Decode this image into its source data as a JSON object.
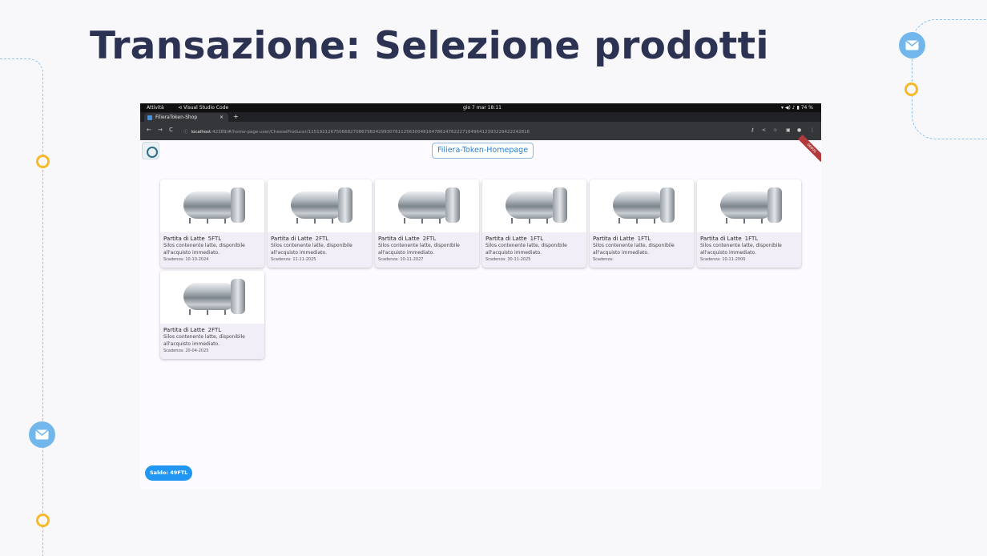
{
  "slide": {
    "title": "Transazione: Selezione prodotti"
  },
  "taskbar": {
    "activities": "Attività",
    "app_name": "Visual Studio Code",
    "clock": "gio 7 mar  18:11",
    "battery": "74 %"
  },
  "browser": {
    "tab_title": "FilieraToken-Shop",
    "url_host": "localhost",
    "url_path": ":42389/#/home-page-user/CheeseProducer/1151921267506682708679824299307611256300481647861476222718496412393229422242816"
  },
  "app": {
    "home_button": "Filiera-Token-Homepage",
    "debug_label": "DEBUG",
    "balance": "Saldo: 49FTL",
    "products": [
      {
        "name": "Partita di Latte",
        "qty": "5FTL",
        "description": "Silos contenente latte, disponibile all'acquisto immediato.",
        "expiry": "Scadenza: 10-10-2024"
      },
      {
        "name": "Partita di Latte",
        "qty": "2FTL",
        "description": "Silos contenente latte, disponibile all'acquisto immediato.",
        "expiry": "Scadenza: 11-11-2025"
      },
      {
        "name": "Partita di Latte",
        "qty": "2FTL",
        "description": "Silos contenente latte, disponibile all'acquisto immediato.",
        "expiry": "Scadenza: 10-11-2027"
      },
      {
        "name": "Partita di Latte",
        "qty": "1FTL",
        "description": "Silos contenente latte, disponibile all'acquisto immediato.",
        "expiry": "Scadenza: 30-11-2025"
      },
      {
        "name": "Partita di Latte",
        "qty": "1FTL",
        "description": "Silos contenente latte, disponibile all'acquisto immediato.",
        "expiry": "Scadenza:"
      },
      {
        "name": "Partita di Latte",
        "qty": "1FTL",
        "description": "Silos contenente latte, disponibile all'acquisto immediato.",
        "expiry": "Scadenza: 10-11-2000"
      },
      {
        "name": "Partita di Latte",
        "qty": "2FTL",
        "description": "Silos contenente latte, disponibile all'acquisto immediato.",
        "expiry": "Scadenza: 20-04-2025"
      }
    ]
  }
}
